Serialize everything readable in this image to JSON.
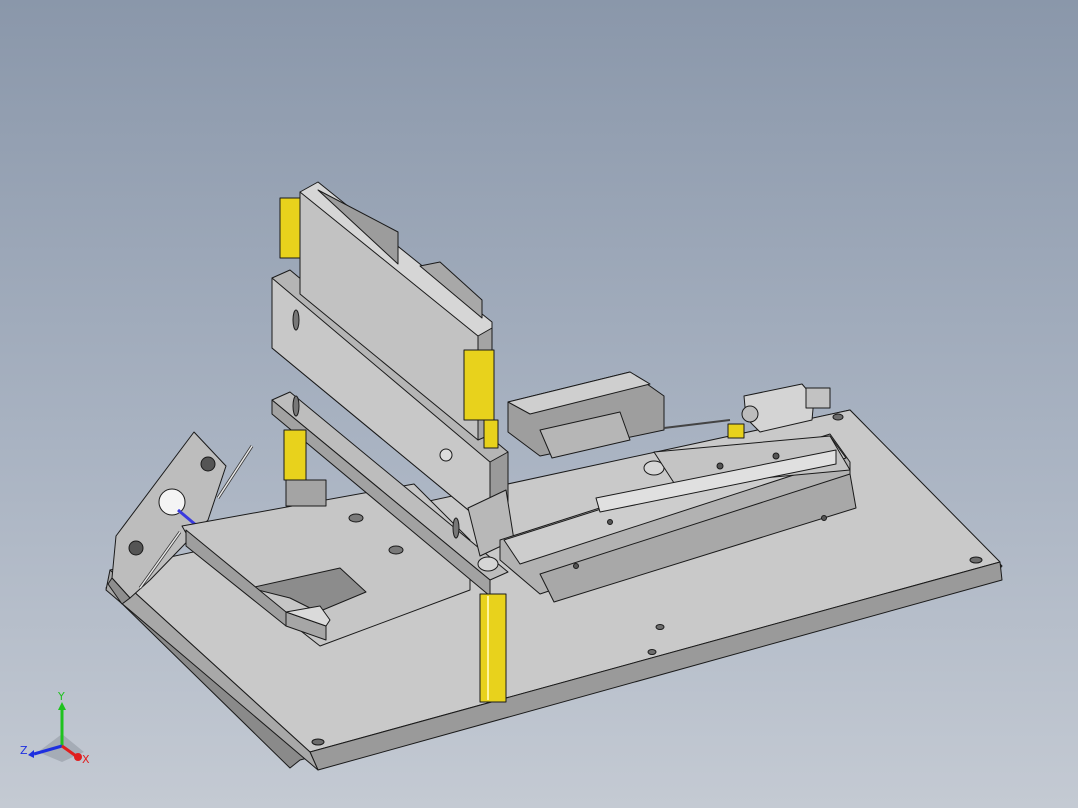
{
  "viewport": {
    "background_top": "#8a97aa",
    "background_bottom": "#c4cad3"
  },
  "model": {
    "body_color": "#c3c3c3",
    "edge_color": "#1a1a1a",
    "accent_yellow": "#e8d21c",
    "accent_blue": "#3a3adf"
  },
  "triad": {
    "y_label": "Y",
    "z_label": "Z",
    "x_label": "X",
    "y_color": "#1fc21f",
    "z_color": "#1e2fe0",
    "x_color": "#e01e1e"
  }
}
